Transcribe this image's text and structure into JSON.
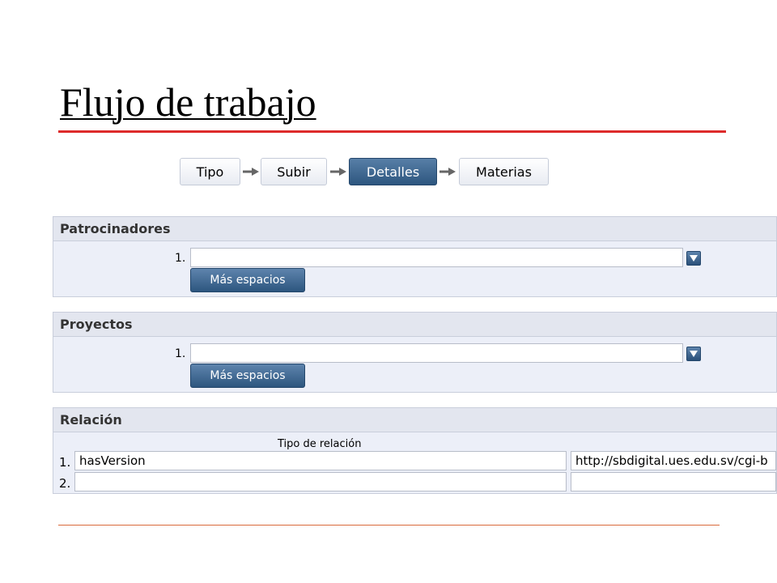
{
  "page": {
    "title": "Flujo de trabajo"
  },
  "workflow": {
    "steps": [
      {
        "label": "Tipo",
        "active": false
      },
      {
        "label": "Subir",
        "active": false
      },
      {
        "label": "Detalles",
        "active": true
      },
      {
        "label": "Materias",
        "active": false
      }
    ]
  },
  "sponsors": {
    "heading": "Patrocinadores",
    "row_number": "1.",
    "value": "",
    "more_button": "Más espacios"
  },
  "projects": {
    "heading": "Proyectos",
    "row_number": "1.",
    "value": "",
    "more_button": "Más espacios"
  },
  "relation": {
    "heading": "Relación",
    "column_header": "Tipo de relación",
    "rows": [
      {
        "number": "1.",
        "type": "hasVersion",
        "uri": "http://sbdigital.ues.edu.sv/cgi-b"
      },
      {
        "number": "2.",
        "type": "",
        "uri": ""
      }
    ]
  },
  "colors": {
    "accent_red": "#dd2b2b",
    "button_blue": "#2d567f",
    "panel_bg": "#eceff8"
  }
}
